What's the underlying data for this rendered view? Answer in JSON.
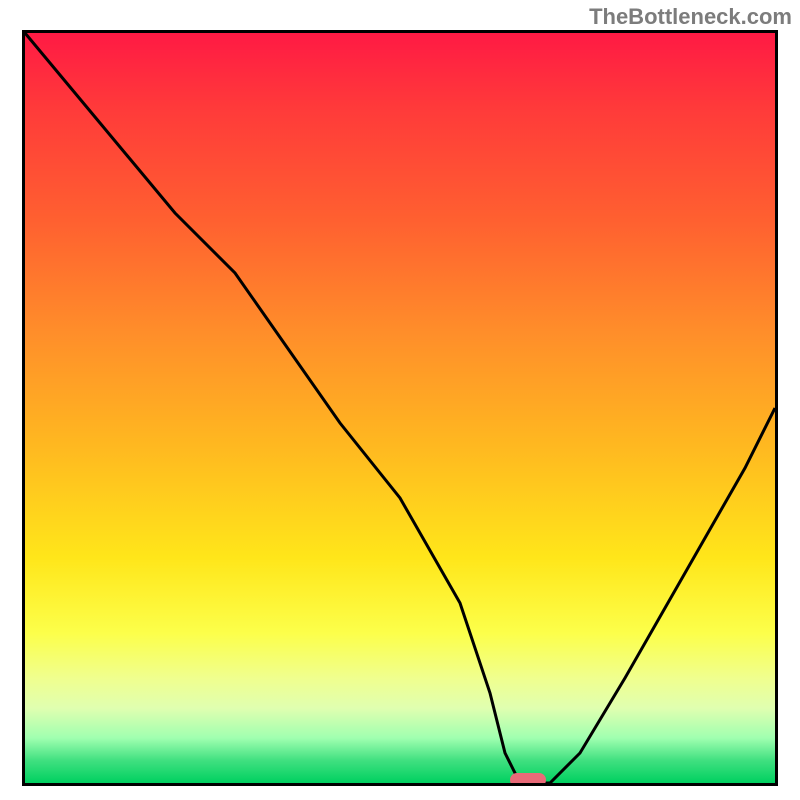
{
  "watermark": "TheBottleneck.com",
  "chart_data": {
    "type": "line",
    "title": "",
    "xlabel": "",
    "ylabel": "",
    "xlim": [
      0,
      100
    ],
    "ylim": [
      0,
      100
    ],
    "gradient": {
      "top_color": "#ff1a44",
      "bottom_color": "#00d060",
      "description": "red-yellow-green vertical gradient (bottleneck severity)"
    },
    "series": [
      {
        "name": "bottleneck-curve",
        "x": [
          0,
          10,
          20,
          28,
          35,
          42,
          50,
          58,
          62,
          64,
          66,
          70,
          74,
          80,
          88,
          96,
          100
        ],
        "y": [
          100,
          88,
          76,
          68,
          58,
          48,
          38,
          24,
          12,
          4,
          0,
          0,
          4,
          14,
          28,
          42,
          50
        ]
      }
    ],
    "marker": {
      "name": "optimal-point",
      "x": 67,
      "y": 0,
      "color": "#e96a78"
    },
    "annotations": []
  }
}
